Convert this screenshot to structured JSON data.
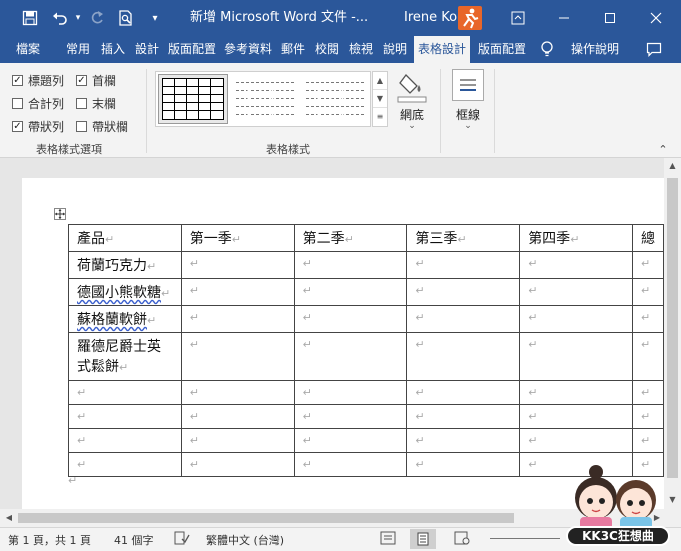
{
  "title_bar": {
    "doc_title": "新增 Microsoft Word 文件  -...",
    "user_name": "Irene Ko",
    "qat_icons": [
      "save-icon",
      "undo-icon",
      "redo-icon",
      "print-preview-icon",
      "customize-qat-icon"
    ],
    "window_icons": [
      "ribbon-display-icon",
      "minimize-icon",
      "maximize-icon",
      "close-icon"
    ]
  },
  "tabs": [
    "檔案",
    "常用",
    "插入",
    "設計",
    "版面配置",
    "參考資料",
    "郵件",
    "校閱",
    "檢視",
    "說明",
    "表格設計",
    "版面配置"
  ],
  "active_tab": "表格設計",
  "tell_me": "操作說明",
  "ribbon": {
    "style_options": [
      {
        "label": "標題列",
        "checked": true
      },
      {
        "label": "首欄",
        "checked": true
      },
      {
        "label": "合計列",
        "checked": false
      },
      {
        "label": "末欄",
        "checked": false
      },
      {
        "label": "帶狀列",
        "checked": true
      },
      {
        "label": "帶狀欄",
        "checked": false
      }
    ],
    "check_mark": "✓",
    "group_style_options": "表格樣式選項",
    "group_table_styles": "表格樣式",
    "shading": "網底",
    "borders": "框線"
  },
  "table": {
    "header": [
      "產品",
      "第一季",
      "第二季",
      "第三季",
      "第四季",
      "總"
    ],
    "rows": [
      [
        "荷蘭巧克力",
        "",
        "",
        "",
        "",
        ""
      ],
      [
        "德國小熊軟糖",
        "",
        "",
        "",
        "",
        ""
      ],
      [
        "蘇格蘭軟餅",
        "",
        "",
        "",
        "",
        ""
      ],
      [
        "羅德尼爵士英式鬆餅",
        "",
        "",
        "",
        "",
        ""
      ],
      [
        "",
        "",
        "",
        "",
        "",
        ""
      ],
      [
        "",
        "",
        "",
        "",
        "",
        ""
      ],
      [
        "",
        "",
        "",
        "",
        "",
        ""
      ],
      [
        "",
        "",
        "",
        "",
        "",
        ""
      ]
    ],
    "mark": "↵"
  },
  "status": {
    "page": "第 1 頁，共 1 頁",
    "words": "41 個字",
    "language": "繁體中文 (台灣)"
  },
  "watermark": "KK3C狂想曲",
  "colors": {
    "word_blue": "#2b579a",
    "ribbon_bg": "#f3f3f3",
    "doc_bg": "#e6e6e6"
  }
}
